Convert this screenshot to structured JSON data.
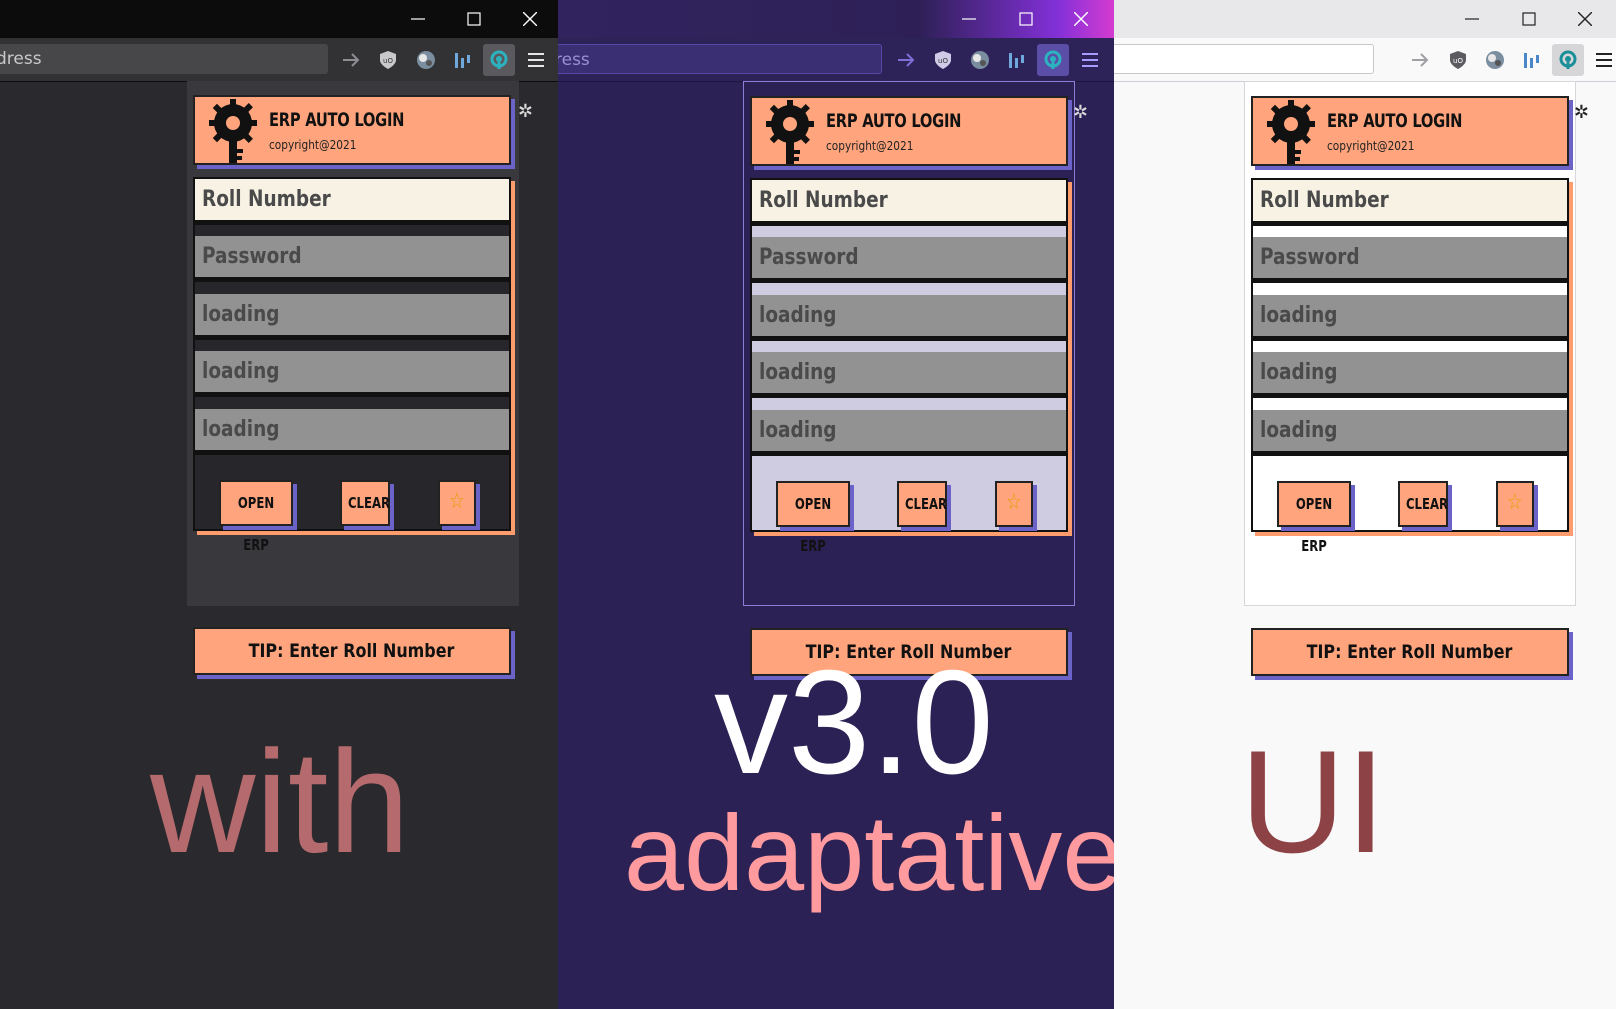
{
  "window": {
    "controls": [
      "minimize-icon",
      "maximize-icon",
      "close-icon"
    ],
    "url_placeholder_fragments": {
      "dark": "dress",
      "purple": "ress",
      "light": ""
    }
  },
  "toolbar_icons": [
    "forward-arrow-icon",
    "ublock-shield-icon",
    "globe-avatar-icon",
    "bars-extension-icon",
    "erp-extension-icon",
    "menu-icon"
  ],
  "popup": {
    "header": {
      "title": "ERP AUTO LOGIN",
      "subtitle": "copyright@2021",
      "logo": "key-gear-logo-icon"
    },
    "fields": [
      "Roll Number",
      "Password",
      "loading",
      "loading",
      "loading"
    ],
    "buttons": {
      "open": "OPEN ERP",
      "clear": "CLEAR",
      "star": "☆"
    },
    "tip": "TIP: Enter Roll Number"
  },
  "overlay_text": {
    "left": "with",
    "center_top": "v3.0",
    "center_bottom": "adaptative",
    "right": "UI"
  },
  "themes": {
    "dark": {
      "background": "#2a2a2e",
      "accent": "#ffa47c",
      "shadow": "#6b63c7"
    },
    "purple": {
      "background": "#2b2154",
      "accent": "#ffa47c",
      "shadow": "#6b63c7"
    },
    "light": {
      "background": "#f9f9fa",
      "accent": "#ffa47c",
      "shadow": "#6b63c7"
    }
  }
}
